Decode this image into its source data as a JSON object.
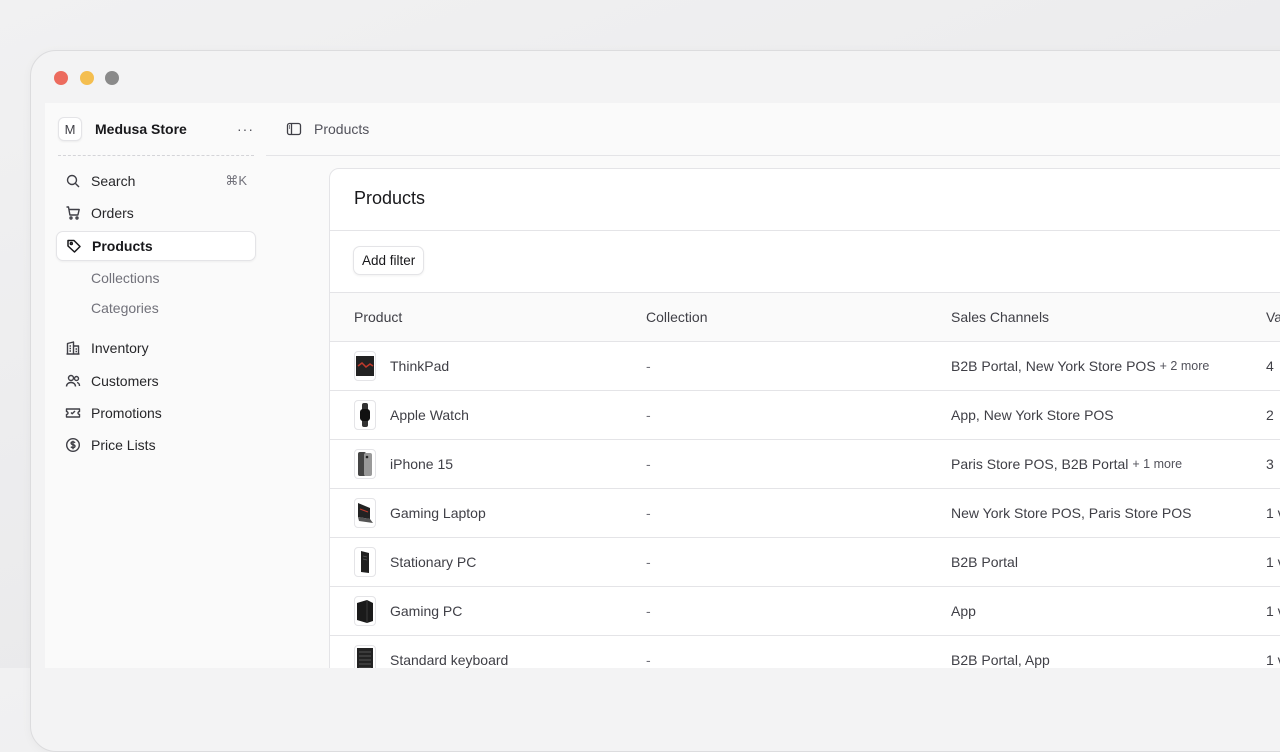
{
  "store": {
    "initial": "M",
    "name": "Medusa Store",
    "more": "···"
  },
  "nav": {
    "search": {
      "label": "Search",
      "shortcut": "⌘K",
      "icon": "search-icon"
    },
    "orders": {
      "label": "Orders",
      "icon": "shopping-cart-icon"
    },
    "products": {
      "label": "Products",
      "icon": "tag-icon"
    },
    "collections": {
      "label": "Collections"
    },
    "categories": {
      "label": "Categories"
    },
    "inventory": {
      "label": "Inventory",
      "icon": "building-icon"
    },
    "customers": {
      "label": "Customers",
      "icon": "users-icon"
    },
    "promotions": {
      "label": "Promotions",
      "icon": "ticket-icon"
    },
    "price_lists": {
      "label": "Price Lists",
      "icon": "currency-dollar-icon"
    }
  },
  "topbar": {
    "breadcrumb": "Products",
    "icon": "sidebar-panel-icon"
  },
  "page": {
    "title": "Products",
    "add_filter": "Add filter"
  },
  "table": {
    "columns": {
      "product": "Product",
      "collection": "Collection",
      "sales_channels": "Sales Channels",
      "variants": "Va"
    },
    "rows": [
      {
        "name": "ThinkPad",
        "collection": "-",
        "channels": "B2B Portal, New York Store POS",
        "more": "+ 2 more",
        "variants": "4",
        "thumb": "laptop"
      },
      {
        "name": "Apple Watch",
        "collection": "-",
        "channels": "App, New York Store POS",
        "more": "",
        "variants": "2",
        "thumb": "watch"
      },
      {
        "name": "iPhone 15",
        "collection": "-",
        "channels": "Paris Store POS, B2B Portal",
        "more": "+ 1 more",
        "variants": "3",
        "thumb": "phone"
      },
      {
        "name": "Gaming Laptop",
        "collection": "-",
        "channels": "New York Store POS, Paris Store POS",
        "more": "",
        "variants": "1 v",
        "thumb": "gaming-laptop"
      },
      {
        "name": "Stationary PC",
        "collection": "-",
        "channels": "B2B Portal",
        "more": "",
        "variants": "1 v",
        "thumb": "pc"
      },
      {
        "name": "Gaming PC",
        "collection": "-",
        "channels": "App",
        "more": "",
        "variants": "1 v",
        "thumb": "gaming-pc"
      },
      {
        "name": "Standard keyboard",
        "collection": "-",
        "channels": "B2B Portal, App",
        "more": "",
        "variants": "1 v",
        "thumb": "keyboard"
      }
    ]
  },
  "colors": {
    "accent_text": "#18181b",
    "muted_text": "#71717a",
    "border": "#e4e4e7"
  }
}
